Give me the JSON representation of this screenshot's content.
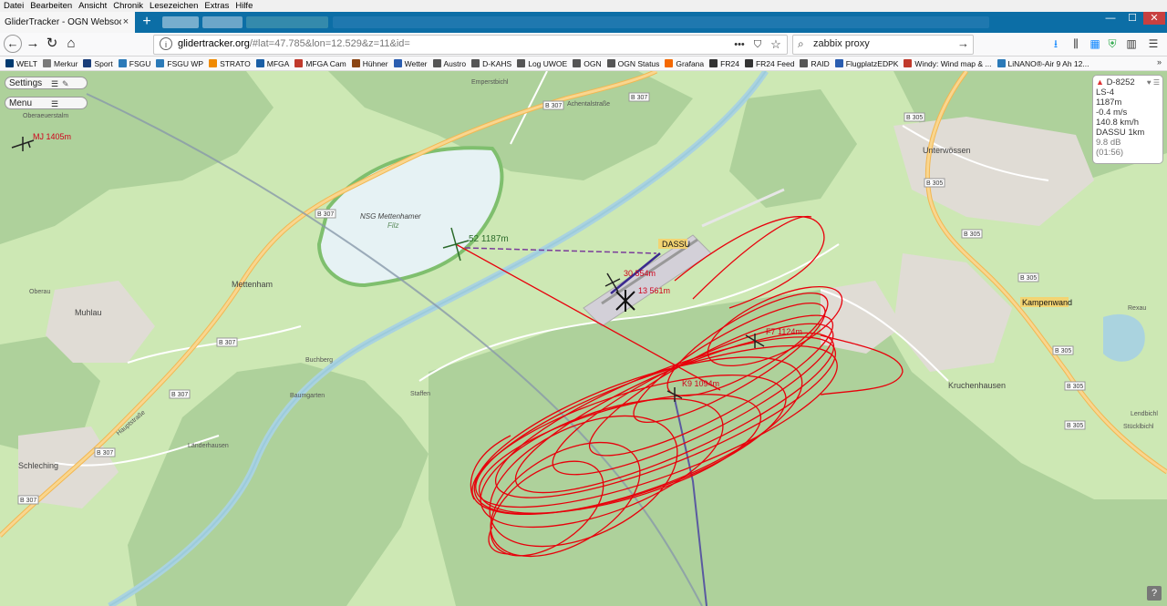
{
  "menubar": {
    "items": [
      "Datei",
      "Bearbeiten",
      "Ansicht",
      "Chronik",
      "Lesezeichen",
      "Extras",
      "Hilfe"
    ]
  },
  "tab": {
    "title": "GliderTracker - OGN Websocket Cli",
    "close": "×"
  },
  "window_controls": {
    "minimize": "—",
    "maximize": "☐",
    "close": "✕"
  },
  "nav": {
    "back": "←",
    "forward": "→",
    "reload": "↻",
    "home": "⌂",
    "url_host": "glidertracker.org",
    "url_rest": "/#lat=47.785&lon=12.529&z=11&id=",
    "search_value": "zabbix proxy",
    "search_go": "→",
    "page_actions": "•••",
    "bookmark_star": "☆",
    "pocket": "⛉"
  },
  "bookmarks": [
    {
      "label": "WELT",
      "color": "#003a70"
    },
    {
      "label": "Merkur",
      "color": "#7a7a7a"
    },
    {
      "label": "Sport",
      "color": "#1a3e7a"
    },
    {
      "label": "FSGU",
      "color": "#2b7ab8"
    },
    {
      "label": "FSGU WP",
      "color": "#2b7ab8"
    },
    {
      "label": "STRATO",
      "color": "#f08a00"
    },
    {
      "label": "MFGA",
      "color": "#1b5fa6"
    },
    {
      "label": "MFGA Cam",
      "color": "#c0392b"
    },
    {
      "label": "Hühner",
      "color": "#8b4513"
    },
    {
      "label": "Wetter",
      "color": "#2a5db0"
    },
    {
      "label": "Austro",
      "color": "#555555"
    },
    {
      "label": "D-KAHS",
      "color": "#555555"
    },
    {
      "label": "Log UWOE",
      "color": "#555555"
    },
    {
      "label": "OGN",
      "color": "#555555"
    },
    {
      "label": "OGN Status",
      "color": "#555555"
    },
    {
      "label": "Grafana",
      "color": "#f46800"
    },
    {
      "label": "FR24",
      "color": "#333333"
    },
    {
      "label": "FR24 Feed",
      "color": "#333333"
    },
    {
      "label": "RAID",
      "color": "#555555"
    },
    {
      "label": "FlugplatzEDPK",
      "color": "#2a5db0"
    },
    {
      "label": "Windy: Wind map & ...",
      "color": "#c0392b"
    },
    {
      "label": "LiNANO®-Air 9 Ah 12...",
      "color": "#2b7ab8"
    }
  ],
  "bookmarks_more": "»",
  "map_controls": {
    "settings_label": "Settings",
    "menu_label": "Menu",
    "hamburger": "☰",
    "pen": "✎"
  },
  "info_panel": {
    "callsign": "D-8252",
    "type": "LS-4",
    "altitude": "1187m",
    "climb": "-0.4 m/s",
    "speed": "140.8 km/h",
    "receiver": "DASSU 1km",
    "signal": "9.8 dB",
    "age": "(01:56)"
  },
  "map": {
    "place_labels": {
      "emperstbichl": "Emperstbichl",
      "nsg1": "NSG Mettenhamer",
      "nsg2": "Filz",
      "mettenham": "Mettenham",
      "muhlau": "Muhlau",
      "oberau": "Oberau",
      "schleching": "Schleching",
      "unterwossen": "Unterwössen",
      "kruchenhausen": "Kruchenhausen",
      "kampenwand": "Kampenwand",
      "dassu": "DASSU",
      "buchberg": "Buchberg",
      "staffen": "Staffen",
      "baumgarten": "Baumgarten",
      "landerhausen": "Länderhausen",
      "reaxu": "Rexau",
      "lendbichl": "Lendbichl",
      "stuckl": "Stücklbichl",
      "oberaeu": "Oberaeuerstalm"
    },
    "road_labels": {
      "b307a": "B 307",
      "b307b": "B 307",
      "b307c": "B 307",
      "b307d": "B 307",
      "b307e": "B 307",
      "b307f": "B 307",
      "b307g": "B 307",
      "b305a": "B 305",
      "b305b": "B 305",
      "b305c": "B 305",
      "b305d": "B 305",
      "b305e": "B 305",
      "b305f": "B 305",
      "b305g": "B 305",
      "achentalstr": "Achentalstraße",
      "hauptstr": "Hauptstraße"
    },
    "aircraft_labels": {
      "mj": "MJ 1405m",
      "a52": "52 1187m",
      "a30": "30 554m",
      "a13": "13 561m",
      "f7": "F7 1124m",
      "k9": "K9 1094m"
    }
  },
  "help_label": "?",
  "colors": {
    "track": "#e8000b",
    "tab_strip": "#0c6ea6",
    "lake": "#e1f0f5",
    "river": "#aad3df",
    "road_major": "#f7c56a",
    "forest": "#aed19b"
  }
}
